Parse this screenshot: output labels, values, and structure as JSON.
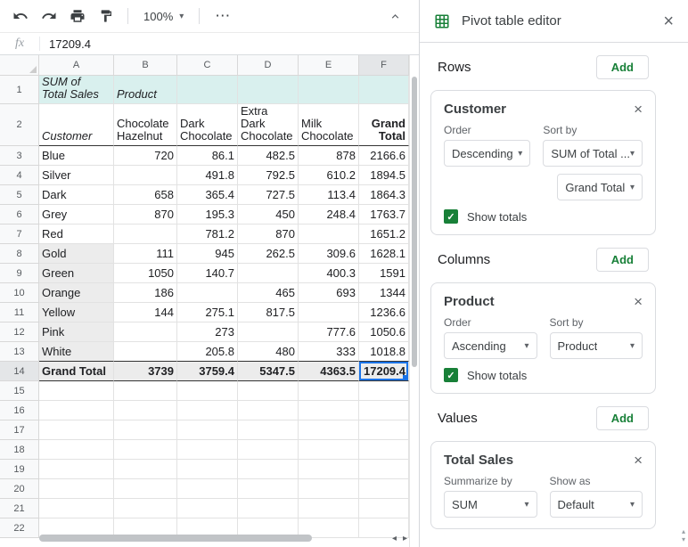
{
  "colors": {
    "accent_green": "#188038",
    "selection_blue": "#1a73e8",
    "pivot_header_bg": "#d9f0ee"
  },
  "icons": {
    "dropdown_arrow": "▾",
    "check": "✓",
    "close": "×",
    "more": "⋯",
    "scroll_left": "◂",
    "scroll_right": "▸",
    "scroll_up": "▴",
    "scroll_down": "▾"
  },
  "toolbar": {
    "zoom": "100%"
  },
  "formula_bar": {
    "fx": "fx",
    "value": "17209.4"
  },
  "grid": {
    "column_headers": [
      "A",
      "B",
      "C",
      "D",
      "E",
      "F"
    ],
    "row_count": 22,
    "selected_cell": "F14",
    "pivot": {
      "a1": "SUM of\nTotal Sales",
      "b1": "Product",
      "a2": "Customer",
      "product_headers": [
        "Chocolate\nHazelnut",
        "Dark\nChocolate",
        "Extra\nDark\nChocolate",
        "Milk\nChocolate",
        "Grand\nTotal"
      ],
      "rows": [
        {
          "label": "Blue",
          "values": [
            "720",
            "86.1",
            "482.5",
            "878",
            "2166.6"
          ]
        },
        {
          "label": "Silver",
          "values": [
            "",
            "491.8",
            "792.5",
            "610.2",
            "1894.5"
          ]
        },
        {
          "label": "Dark",
          "values": [
            "658",
            "365.4",
            "727.5",
            "113.4",
            "1864.3"
          ]
        },
        {
          "label": "Grey",
          "values": [
            "870",
            "195.3",
            "450",
            "248.4",
            "1763.7"
          ]
        },
        {
          "label": "Red",
          "values": [
            "",
            "781.2",
            "870",
            "",
            "1651.2"
          ]
        },
        {
          "label": "Gold",
          "values": [
            "111",
            "945",
            "262.5",
            "309.6",
            "1628.1"
          ]
        },
        {
          "label": "Green",
          "values": [
            "1050",
            "140.7",
            "",
            "400.3",
            "1591"
          ]
        },
        {
          "label": "Orange",
          "values": [
            "186",
            "",
            "465",
            "693",
            "1344"
          ]
        },
        {
          "label": "Yellow",
          "values": [
            "144",
            "275.1",
            "817.5",
            "",
            "1236.6"
          ]
        },
        {
          "label": "Pink",
          "values": [
            "",
            "273",
            "",
            "777.6",
            "1050.6"
          ]
        },
        {
          "label": "White",
          "values": [
            "",
            "205.8",
            "480",
            "333",
            "1018.8"
          ]
        }
      ],
      "total_row": {
        "label": "Grand Total",
        "values": [
          "3739",
          "3759.4",
          "5347.5",
          "4363.5",
          "17209.4"
        ]
      }
    }
  },
  "panel": {
    "title": "Pivot table editor",
    "sections": {
      "rows": {
        "heading": "Rows",
        "add": "Add",
        "card": {
          "title": "Customer",
          "order_label": "Order",
          "order": "Descending",
          "sort_label": "Sort by",
          "sort": "SUM of Total ...",
          "sort_secondary": "Grand Total",
          "show_totals": "Show totals"
        }
      },
      "columns": {
        "heading": "Columns",
        "add": "Add",
        "card": {
          "title": "Product",
          "order_label": "Order",
          "order": "Ascending",
          "sort_label": "Sort by",
          "sort": "Product",
          "show_totals": "Show totals"
        }
      },
      "values": {
        "heading": "Values",
        "add": "Add",
        "card": {
          "title": "Total Sales",
          "summarize_label": "Summarize by",
          "summarize": "SUM",
          "show_as_label": "Show as",
          "show_as": "Default"
        }
      }
    }
  }
}
